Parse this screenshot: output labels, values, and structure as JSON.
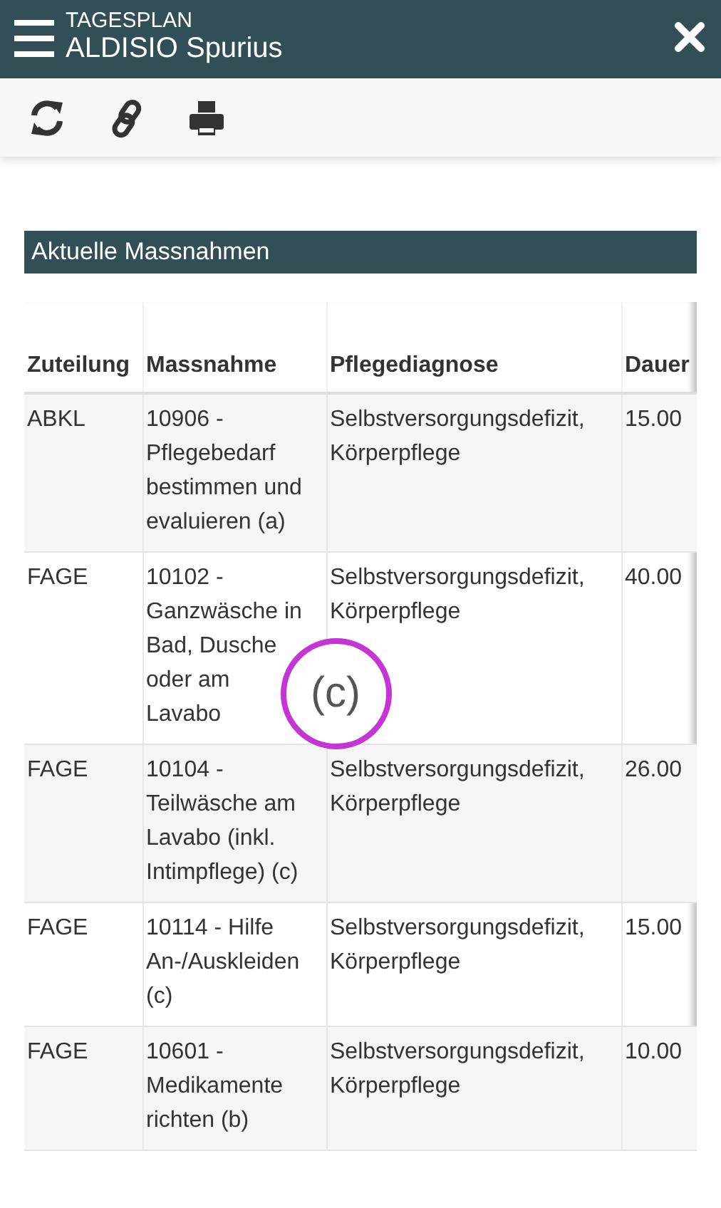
{
  "header": {
    "subtitle": "TAGESPLAN",
    "title": "ALDISIO Spurius"
  },
  "section": {
    "title": "Aktuelle Massnahmen"
  },
  "table": {
    "columns": [
      "Zuteilung",
      "Massnahme",
      "Pflegediagnose",
      "Dauer"
    ],
    "rows": [
      {
        "cells": [
          "ABKL",
          "10906 - Pflegebedarf bestimmen und evaluieren (a)",
          "Selbstversorgungsdefizit, Körperpflege",
          "15.00"
        ]
      },
      {
        "cells": [
          "FAGE",
          "10102 - Ganzwäsche in Bad, Dusche oder am Lavabo",
          "Selbstversorgungsdefizit, Körperpflege",
          "40.00"
        ],
        "magnifier": "(c)"
      },
      {
        "cells": [
          "FAGE",
          "10104 - Teilwäsche am Lavabo (inkl. Intimpflege) (c)",
          "Selbstversorgungsdefizit, Körperpflege",
          "26.00"
        ]
      },
      {
        "cells": [
          "FAGE",
          "10114 - Hilfe An-/Auskleiden (c)",
          "Selbstversorgungsdefizit, Körperpflege",
          "15.00"
        ]
      },
      {
        "cells": [
          "FAGE",
          "10601 - Medikamente richten (b)",
          "Selbstversorgungsdefizit, Körperpflege",
          "10.00"
        ]
      }
    ]
  }
}
